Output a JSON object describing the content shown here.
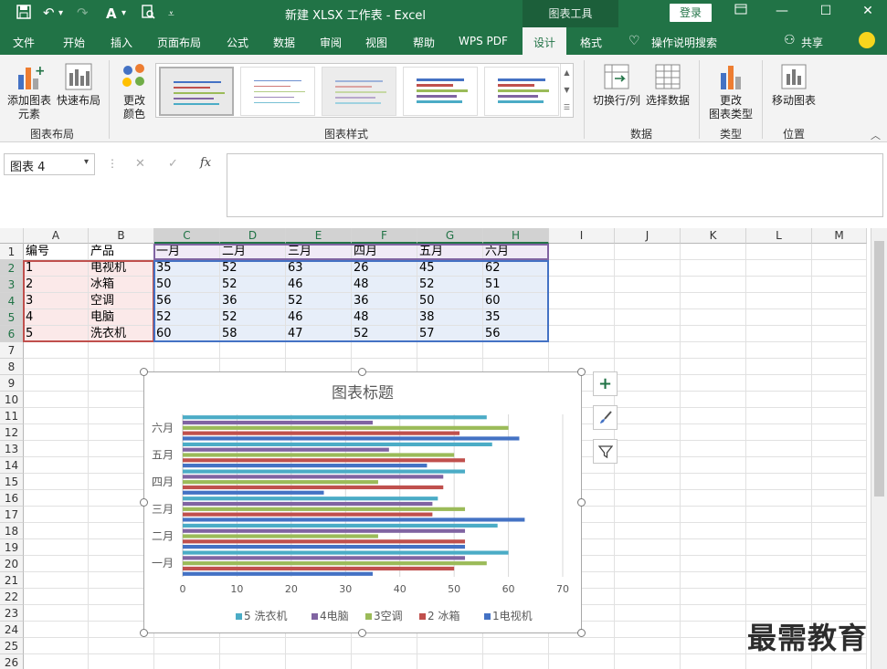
{
  "titlebar": {
    "title": "新建 XLSX 工作表  -  Excel",
    "context_tab": "图表工具",
    "login": "登录",
    "qa_undo": "↶",
    "qa_redo": "↷"
  },
  "tabs": [
    "文件",
    "开始",
    "插入",
    "页面布局",
    "公式",
    "数据",
    "审阅",
    "视图",
    "帮助",
    "WPS PDF",
    "设计",
    "格式"
  ],
  "active_tab": "设计",
  "tell_me": "操作说明搜索",
  "share": "共享",
  "ribbon": {
    "add_element": [
      "添加图表",
      "元素"
    ],
    "quick_layout": "快速布局",
    "change_colors": [
      "更改",
      "颜色"
    ],
    "group_layout": "图表布局",
    "group_styles": "图表样式",
    "switch_rowcol": "切换行/列",
    "select_data": "选择数据",
    "group_data": "数据",
    "change_type": [
      "更改",
      "图表类型"
    ],
    "group_type": "类型",
    "move_chart": "移动图表",
    "group_location": "位置"
  },
  "formula_bar": {
    "name_box": "图表 4",
    "fx": "fx",
    "cancel": "✕",
    "confirm": "✓"
  },
  "columns": [
    "A",
    "B",
    "C",
    "D",
    "E",
    "F",
    "G",
    "H",
    "I",
    "J",
    "K",
    "L",
    "M"
  ],
  "rows": [
    "1",
    "2",
    "3",
    "4",
    "5",
    "6",
    "7",
    "8",
    "9",
    "10",
    "11",
    "12",
    "13",
    "14",
    "15",
    "16",
    "17",
    "18",
    "19",
    "20",
    "21",
    "22",
    "23",
    "24",
    "25",
    "26"
  ],
  "sheet": [
    [
      "编号",
      "产品",
      "一月",
      "二月",
      "三月",
      "四月",
      "五月",
      "六月"
    ],
    [
      "1",
      "电视机",
      "35",
      "52",
      "63",
      "26",
      "45",
      "62"
    ],
    [
      "2",
      "冰箱",
      "50",
      "52",
      "46",
      "48",
      "52",
      "51"
    ],
    [
      "3",
      "空调",
      "56",
      "36",
      "52",
      "36",
      "50",
      "60"
    ],
    [
      "4",
      "电脑",
      "52",
      "52",
      "46",
      "48",
      "38",
      "35"
    ],
    [
      "5",
      "洗衣机",
      "60",
      "58",
      "47",
      "52",
      "57",
      "56"
    ]
  ],
  "chart_data": {
    "type": "bar",
    "orientation": "horizontal",
    "title": "图表标题",
    "categories": [
      "一月",
      "二月",
      "三月",
      "四月",
      "五月",
      "六月"
    ],
    "series": [
      {
        "name": "1电视机",
        "values": [
          35,
          52,
          63,
          26,
          45,
          62
        ],
        "color": "#4472c4"
      },
      {
        "name": "2 冰箱",
        "values": [
          50,
          52,
          46,
          48,
          52,
          51
        ],
        "color": "#c0504d"
      },
      {
        "name": "3空调",
        "values": [
          56,
          36,
          52,
          36,
          50,
          60
        ],
        "color": "#9bbb59"
      },
      {
        "name": "4电脑",
        "values": [
          52,
          52,
          46,
          48,
          38,
          35
        ],
        "color": "#8064a2"
      },
      {
        "name": "5 洗衣机",
        "values": [
          60,
          58,
          47,
          52,
          57,
          56
        ],
        "color": "#4bacc6"
      }
    ],
    "legend_order": [
      "5 洗衣机",
      "4电脑",
      "3空调",
      "2 冰箱",
      "1电视机"
    ],
    "xlim": [
      0,
      70
    ],
    "xticks": [
      "0",
      "10",
      "20",
      "30",
      "40",
      "50",
      "60",
      "70"
    ],
    "legend": "bottom",
    "grid": true
  },
  "watermark": "最需教育"
}
